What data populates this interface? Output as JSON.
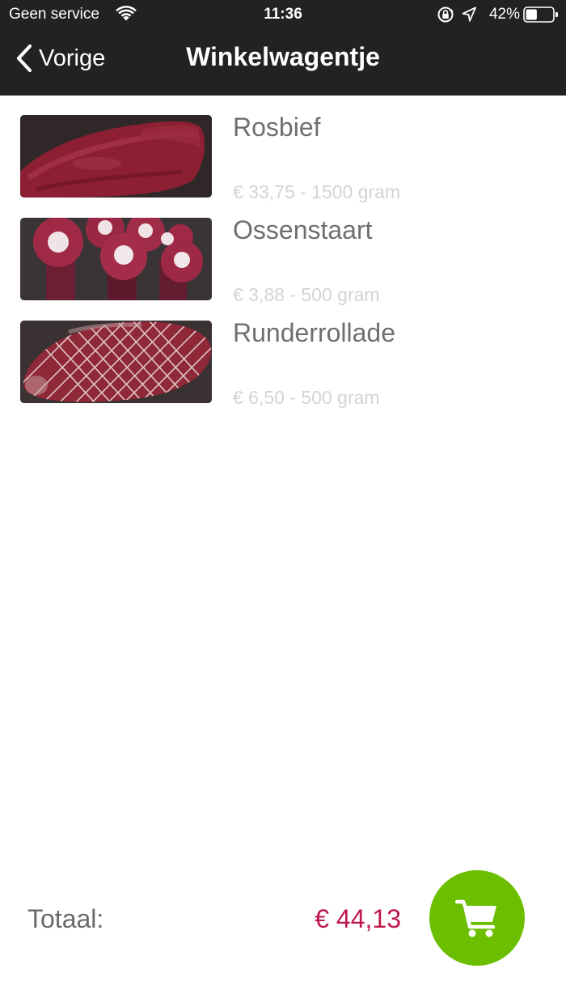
{
  "status_bar": {
    "carrier": "Geen service",
    "time": "11:36",
    "battery_percent": "42%",
    "battery_level": 0.42,
    "icons": [
      "wifi-icon",
      "rotation-lock-icon",
      "location-arrow-icon",
      "battery-icon"
    ]
  },
  "nav": {
    "back_label": "Vorige",
    "back_icon": "chevron-left-icon",
    "title": "Winkelwagentje"
  },
  "items": [
    {
      "name": "Rosbief",
      "price": "€ 33,75 - 1500 gram",
      "image": "roast-beef-photo"
    },
    {
      "name": "Ossenstaart",
      "price": "€ 3,88 - 500 gram",
      "image": "oxtail-photo"
    },
    {
      "name": "Runderrollade",
      "price": "€ 6,50 - 500 gram",
      "image": "beef-roll-photo"
    }
  ],
  "footer": {
    "total_label": "Totaal:",
    "total_value": "€ 44,13",
    "cart_icon": "shopping-cart-icon"
  },
  "colors": {
    "header_bg": "#222222",
    "total_accent": "#c0174a",
    "cart_button": "#6cbf00",
    "item_name": "#6f6f6f",
    "item_price": "#d4d4d4"
  }
}
